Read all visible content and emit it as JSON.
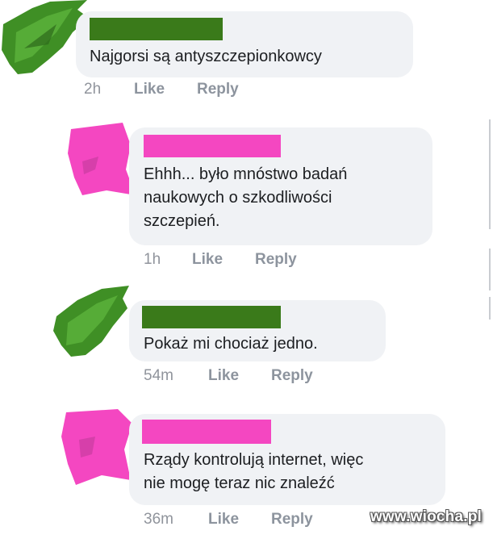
{
  "comments": [
    {
      "text_lines": [
        "Najgorsi są antyszczepionkowcy"
      ],
      "time": "2h",
      "like_label": "Like",
      "reply_label": "Reply",
      "author_color": "#3a7a1a",
      "avatar": "green-scribble-avatar"
    },
    {
      "text_lines": [
        "Ehhh... było mnóstwo badań",
        "naukowych o szkodliwości",
        "szczepień."
      ],
      "time": "1h",
      "like_label": "Like",
      "reply_label": "Reply",
      "author_color": "#f447c1",
      "avatar": "pink-scribble-avatar"
    },
    {
      "text_lines": [
        "Pokaż mi chociaż jedno."
      ],
      "time": "54m",
      "like_label": "Like",
      "reply_label": "Reply",
      "author_color": "#3a7a1a",
      "avatar": "green-scribble-avatar"
    },
    {
      "text_lines": [
        "Rządy kontrolują internet, więc",
        "nie mogę teraz nic znaleźć"
      ],
      "time": "36m",
      "like_label": "Like",
      "reply_label": "Reply",
      "author_color": "#f447c1",
      "avatar": "pink-scribble-avatar"
    }
  ],
  "watermark": "www.wiocha.pl",
  "colors": {
    "bubble": "#f0f2f5",
    "meta_text": "#90949c",
    "green_redaction": "#3a7a1a",
    "pink_redaction": "#f447c1"
  }
}
